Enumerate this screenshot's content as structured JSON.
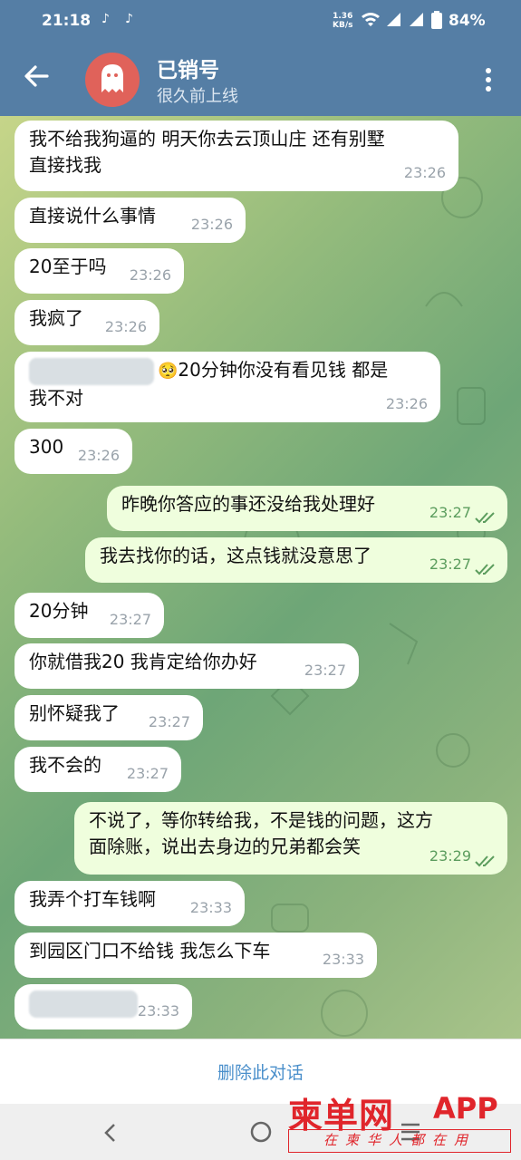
{
  "status_bar": {
    "time": "21:18",
    "tiktok_icons": [
      "tiktok-icon",
      "tiktok-icon"
    ],
    "net_speed_value": "1.36",
    "net_speed_unit": "KB/s",
    "battery": "84%"
  },
  "header": {
    "title": "已销号",
    "subtitle": "很久前上线"
  },
  "messages": [
    {
      "dir": "in",
      "lines": [
        "我不给我狗逼的 明天你去云顶山庄 还有别墅",
        "直接找我"
      ],
      "time": "23:26"
    },
    {
      "dir": "in",
      "lines": [
        "直接说什么事情"
      ],
      "time": "23:26"
    },
    {
      "dir": "in",
      "lines": [
        "20至于吗"
      ],
      "time": "23:26"
    },
    {
      "dir": "in",
      "lines": [
        "我疯了"
      ],
      "time": "23:26"
    },
    {
      "dir": "in",
      "lines": [
        "20分钟你没有看见钱 都是",
        "我不对"
      ],
      "time": "23:26",
      "emoji": "🥺"
    },
    {
      "dir": "in",
      "lines": [
        "300"
      ],
      "time": "23:26"
    },
    {
      "dir": "out",
      "lines": [
        "昨晚你答应的事还没给我处理好"
      ],
      "time": "23:27"
    },
    {
      "dir": "out",
      "lines": [
        "我去找你的话，这点钱就没意思了"
      ],
      "time": "23:27"
    },
    {
      "dir": "in",
      "lines": [
        "20分钟"
      ],
      "time": "23:27"
    },
    {
      "dir": "in",
      "lines": [
        "你就借我20 我肯定给你办好"
      ],
      "time": "23:27"
    },
    {
      "dir": "in",
      "lines": [
        "别怀疑我了"
      ],
      "time": "23:27"
    },
    {
      "dir": "in",
      "lines": [
        "我不会的"
      ],
      "time": "23:27"
    },
    {
      "dir": "out",
      "lines": [
        "不说了，等你转给我，不是钱的问题，这方",
        "面除账，说出去身边的兄弟都会笑"
      ],
      "time": "23:29"
    },
    {
      "dir": "in",
      "lines": [
        "我弄个打车钱啊"
      ],
      "time": "23:33"
    },
    {
      "dir": "in",
      "lines": [
        "到园区门口不给钱 我怎么下车"
      ],
      "time": "23:33"
    },
    {
      "dir": "in",
      "lines": [
        ""
      ],
      "time": "23:33"
    }
  ],
  "bottom": {
    "delete_label": "删除此对话"
  },
  "watermark": {
    "brand": "柬单网",
    "app": "APP",
    "slogan": "在柬华人都在用",
    "color": "#e0252b"
  },
  "colors": {
    "header_bg": "#557ea5",
    "incoming_bubble": "#ffffff",
    "outgoing_bubble": "#effedd",
    "link_blue": "#4a8fcb"
  }
}
